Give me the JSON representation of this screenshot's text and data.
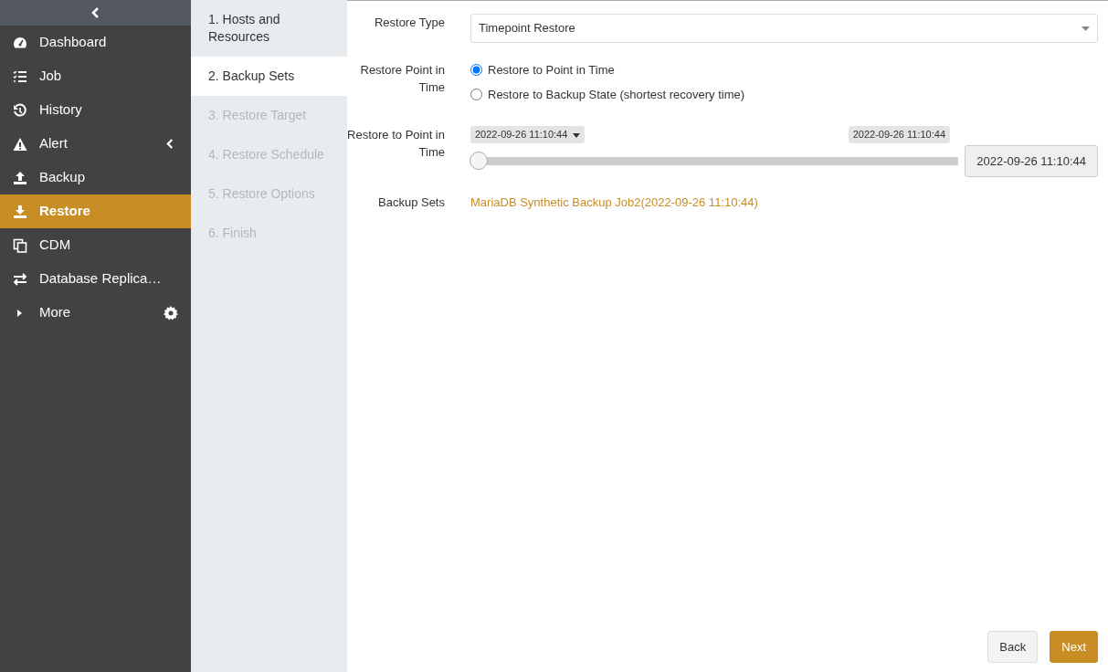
{
  "sidebar": {
    "items": [
      {
        "label": "Dashboard",
        "selected": false,
        "kind": "link"
      },
      {
        "label": "Job",
        "selected": false,
        "kind": "link"
      },
      {
        "label": "History",
        "selected": false,
        "kind": "link"
      },
      {
        "label": "Alert",
        "selected": false,
        "kind": "group"
      },
      {
        "label": "Backup",
        "selected": false,
        "kind": "link"
      },
      {
        "label": "Restore",
        "selected": true,
        "kind": "link"
      },
      {
        "label": "CDM",
        "selected": false,
        "kind": "link"
      },
      {
        "label": "Database Replica…",
        "selected": false,
        "kind": "link"
      },
      {
        "label": "More",
        "selected": false,
        "kind": "more"
      }
    ]
  },
  "steps": [
    {
      "label": "1. Hosts and Resources",
      "selected": false,
      "disabled": false
    },
    {
      "label": "2. Backup Sets",
      "selected": true,
      "disabled": false
    },
    {
      "label": "3. Restore Target",
      "selected": false,
      "disabled": true
    },
    {
      "label": "4. Restore Schedule",
      "selected": false,
      "disabled": true
    },
    {
      "label": "5. Restore Options",
      "selected": false,
      "disabled": true
    },
    {
      "label": "6. Finish",
      "selected": false,
      "disabled": true
    }
  ],
  "form": {
    "restore_type": {
      "label": "Restore Type",
      "value": "Timepoint Restore"
    },
    "restore_point": {
      "label": "Restore Point in Time",
      "options": [
        {
          "label": "Restore to Point in Time",
          "selected": true
        },
        {
          "label": "Restore to Backup State (shortest recovery time)",
          "selected": false
        }
      ]
    },
    "timepoint": {
      "label": "Restore to Point in Time",
      "start": "2022-09-26 11:10:44",
      "end": "2022-09-26 11:10:44",
      "level": 0,
      "value": "2022-09-26 11:10:44"
    },
    "backup_sets": {
      "label": "Backup Sets",
      "value": "MariaDB Synthetic Backup Job2(2022-09-26 11:10:44)"
    }
  },
  "buttons": [
    {
      "label": "Back",
      "kind": "secondary"
    },
    {
      "label": "Next",
      "kind": "primary"
    }
  ]
}
